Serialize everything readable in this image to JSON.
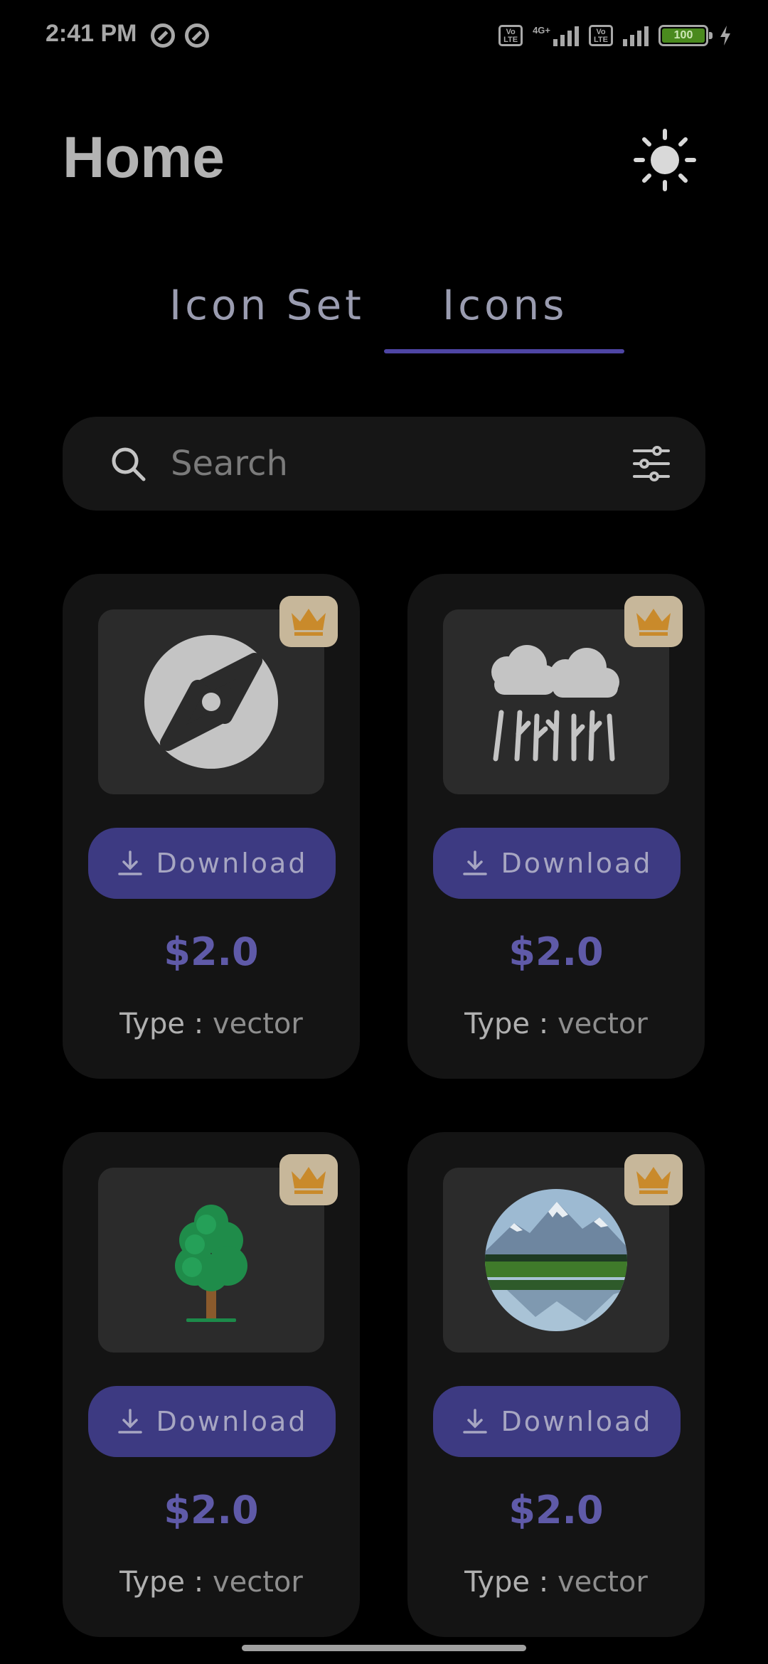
{
  "status_bar": {
    "time": "2:41 PM",
    "network_label": "4G+",
    "volte_label": "Vo LTE",
    "battery": "100"
  },
  "header": {
    "title": "Home",
    "theme_icon": "sun-icon"
  },
  "tabs": [
    {
      "label": "Icon Set",
      "active": false
    },
    {
      "label": "Icons",
      "active": true
    }
  ],
  "search": {
    "placeholder": "Search",
    "value": ""
  },
  "colors": {
    "accent": "#4e45a4",
    "button": "#3d3a82",
    "price": "#5f5aa8",
    "badge": "#c7b79a",
    "crown": "#c98a2b"
  },
  "items": [
    {
      "image": "compass-icon",
      "button_label": "Download",
      "price": "$2.0",
      "type_label": "Type",
      "type_sep": ":",
      "type_value": "vector",
      "premium": true
    },
    {
      "image": "clouds-forest-icon",
      "button_label": "Download",
      "price": "$2.0",
      "type_label": "Type",
      "type_sep": ":",
      "type_value": "vector",
      "premium": true
    },
    {
      "image": "tree-icon",
      "button_label": "Download",
      "price": "$2.0",
      "type_label": "Type",
      "type_sep": ":",
      "type_value": "vector",
      "premium": true
    },
    {
      "image": "mountain-lake-icon",
      "button_label": "Download",
      "price": "$2.0",
      "type_label": "Type",
      "type_sep": ":",
      "type_value": "vector",
      "premium": true
    }
  ]
}
